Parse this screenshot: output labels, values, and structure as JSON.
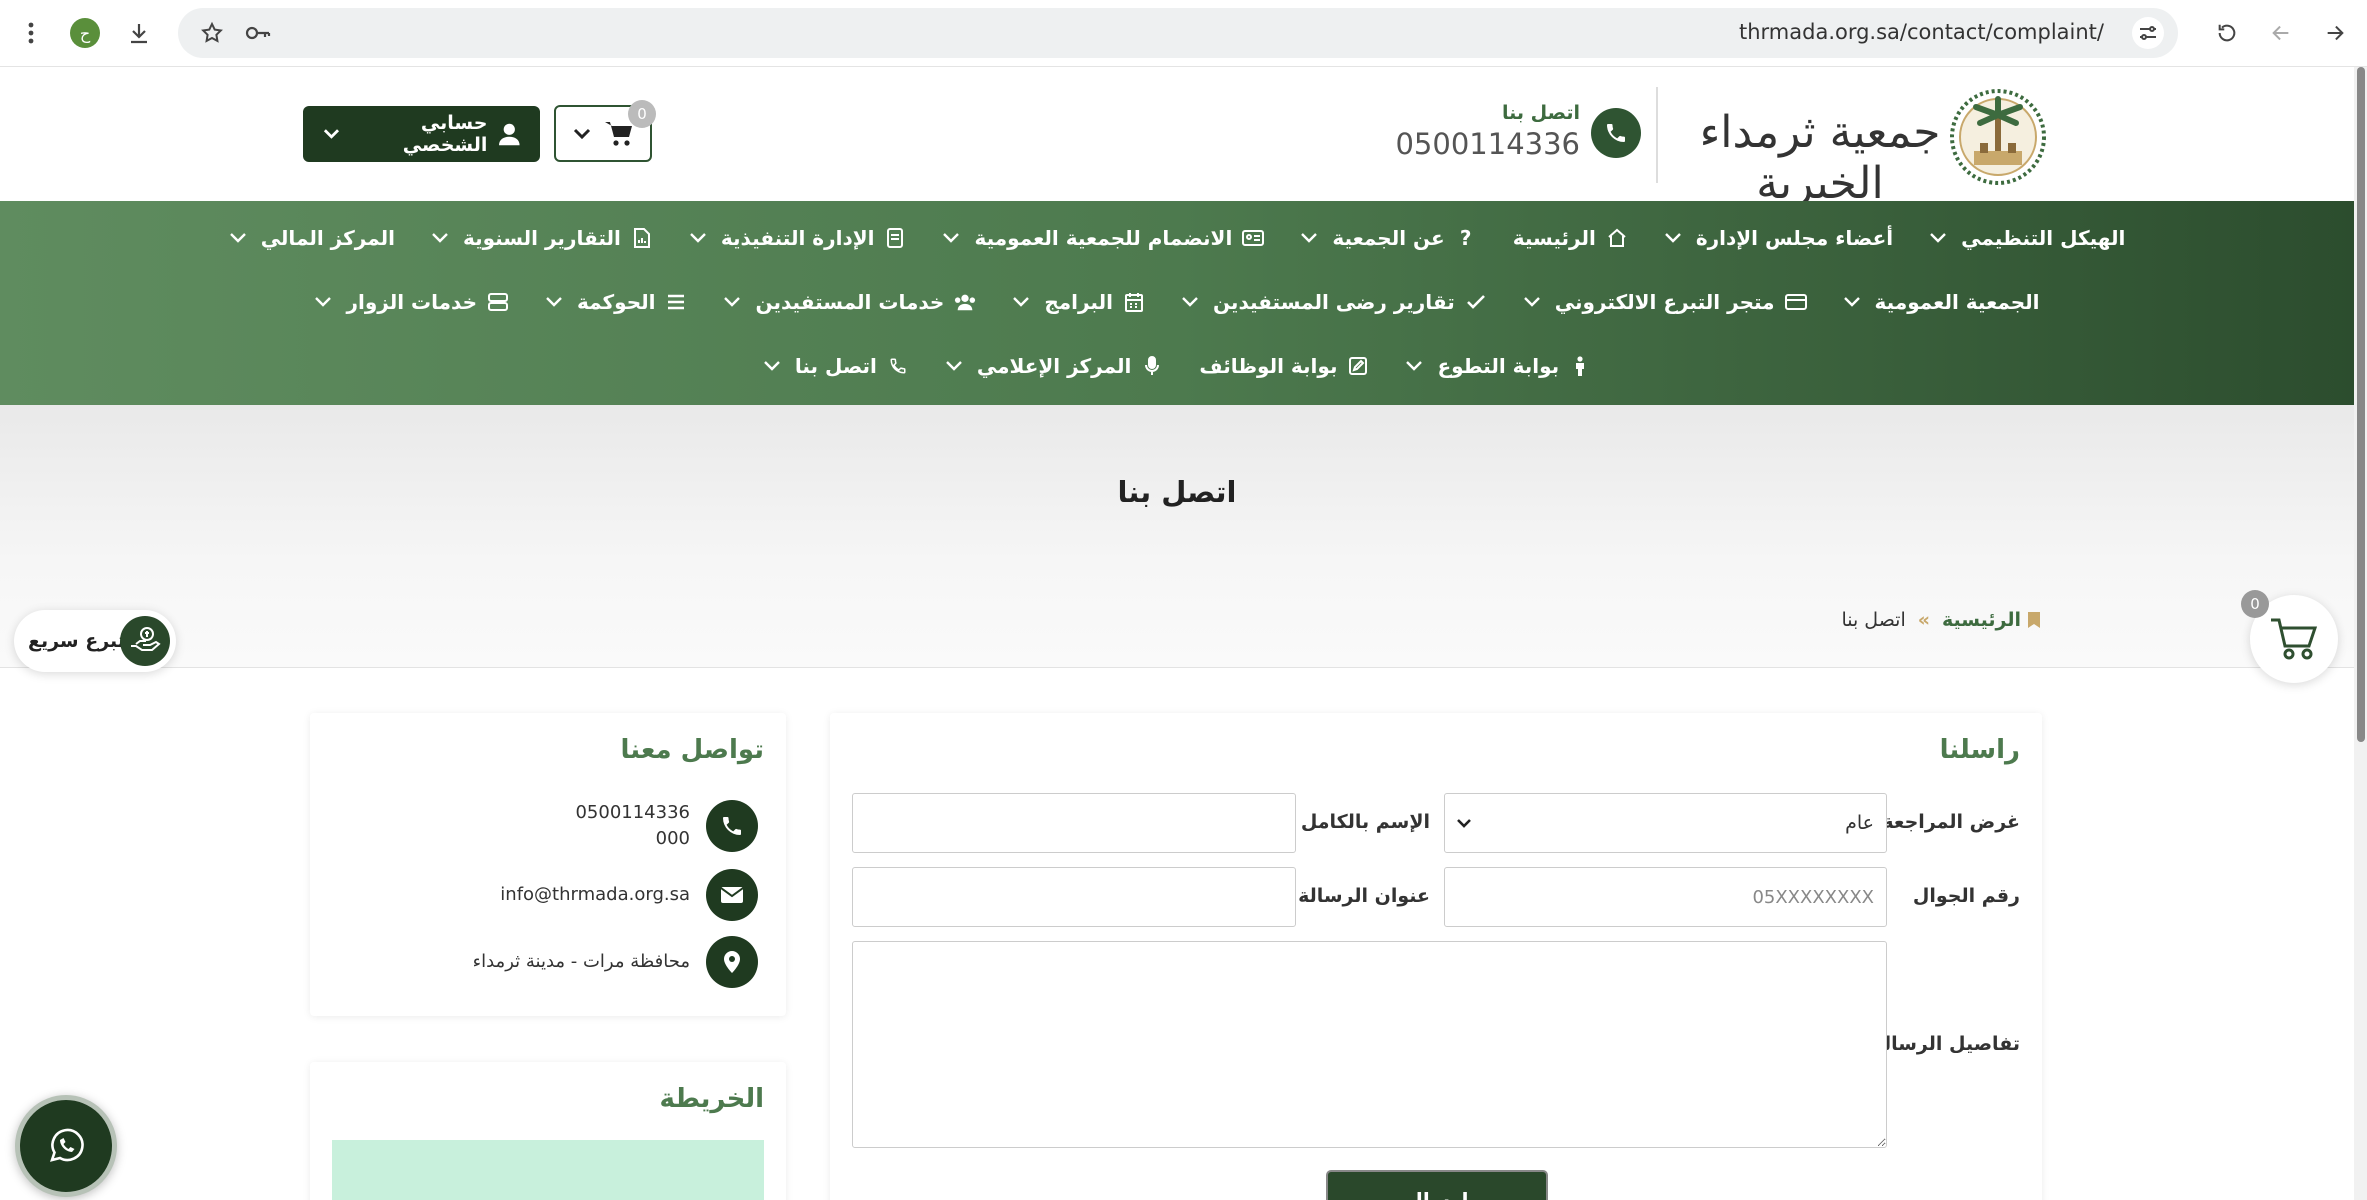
{
  "browser": {
    "url": "thrmada.org.sa/contact/complaint/",
    "extension_badge": "ح",
    "icons": [
      "menu-icon",
      "extension-icon",
      "download-icon",
      "star-icon",
      "password-key-icon",
      "site-settings-icon",
      "reload-icon",
      "back-icon",
      "forward-icon"
    ]
  },
  "header": {
    "logo_text": "جمعية ثرمداء الخيرية",
    "contact_title": "اتصل بنا",
    "contact_phone": "0500114336",
    "cart_count": "0",
    "account_label": "حسابي الشخصي"
  },
  "nav": {
    "row1": [
      {
        "label": "الهيكل التنظيمي",
        "icon": ""
      },
      {
        "label": "أعضاء مجلس الإدارة",
        "icon": ""
      },
      {
        "label": "الرئيسية",
        "icon": "home-icon"
      },
      {
        "label": "عن الجمعية",
        "icon": "question-icon"
      },
      {
        "label": "الانضمام للجمعية العمومية",
        "icon": "id-card-icon"
      },
      {
        "label": "الإدارة التنفيذية",
        "icon": "file-icon"
      },
      {
        "label": "التقارير السنوية",
        "icon": "report-icon"
      },
      {
        "label": "المركز المالي",
        "icon": ""
      }
    ],
    "row2": [
      {
        "label": "الجمعية العمومية",
        "icon": ""
      },
      {
        "label": "متجر التبرع الالكتروني",
        "icon": "credit-card-icon"
      },
      {
        "label": "تقارير رضى المستفيدين",
        "icon": "check-icon"
      },
      {
        "label": "البرامج",
        "icon": "calendar-icon"
      },
      {
        "label": "خدمات المستفيدين",
        "icon": "users-icon"
      },
      {
        "label": "الحوكمة",
        "icon": "list-icon"
      },
      {
        "label": "خدمات الزوار",
        "icon": "server-icon"
      }
    ],
    "row3": [
      {
        "label": "بوابة التطوع",
        "icon": "person-icon"
      },
      {
        "label": "بوابة الوظائف",
        "icon": "edit-icon"
      },
      {
        "label": "المركز الإعلامي",
        "icon": "microphone-icon"
      },
      {
        "label": "اتصل بنا",
        "icon": "phone-icon"
      }
    ]
  },
  "hero": {
    "title": "اتصل بنا",
    "breadcrumb_home": "الرئيسية",
    "breadcrumb_sep": "»",
    "breadcrumb_current": "اتصل بنا"
  },
  "quick_donate": {
    "label": "تبرع سريع"
  },
  "floating_cart": {
    "count": "0"
  },
  "contact_card": {
    "title": "تواصل معنا",
    "phone_line1": "0500114336",
    "phone_line2": "000",
    "email": "info@thrmada.org.sa",
    "address": "محافظة مرات - مدينة ثرمداء"
  },
  "map_card": {
    "title": "الخريطة"
  },
  "form": {
    "title": "راسلنا",
    "purpose_label": "غرض المراجعة",
    "purpose_value": "عام",
    "name_label": "الإسم بالكامل",
    "name_value": "",
    "mobile_label": "رقم الجوال",
    "mobile_placeholder": "05XXXXXXXX",
    "subject_label": "عنوان الرسالة",
    "subject_value": "",
    "details_label": "تفاصيل الرسالة",
    "send_label": "إرسال"
  },
  "colors": {
    "brand_dark": "#1f3a20",
    "brand": "#4d7a4e",
    "accent_gold": "#c8a86b"
  }
}
